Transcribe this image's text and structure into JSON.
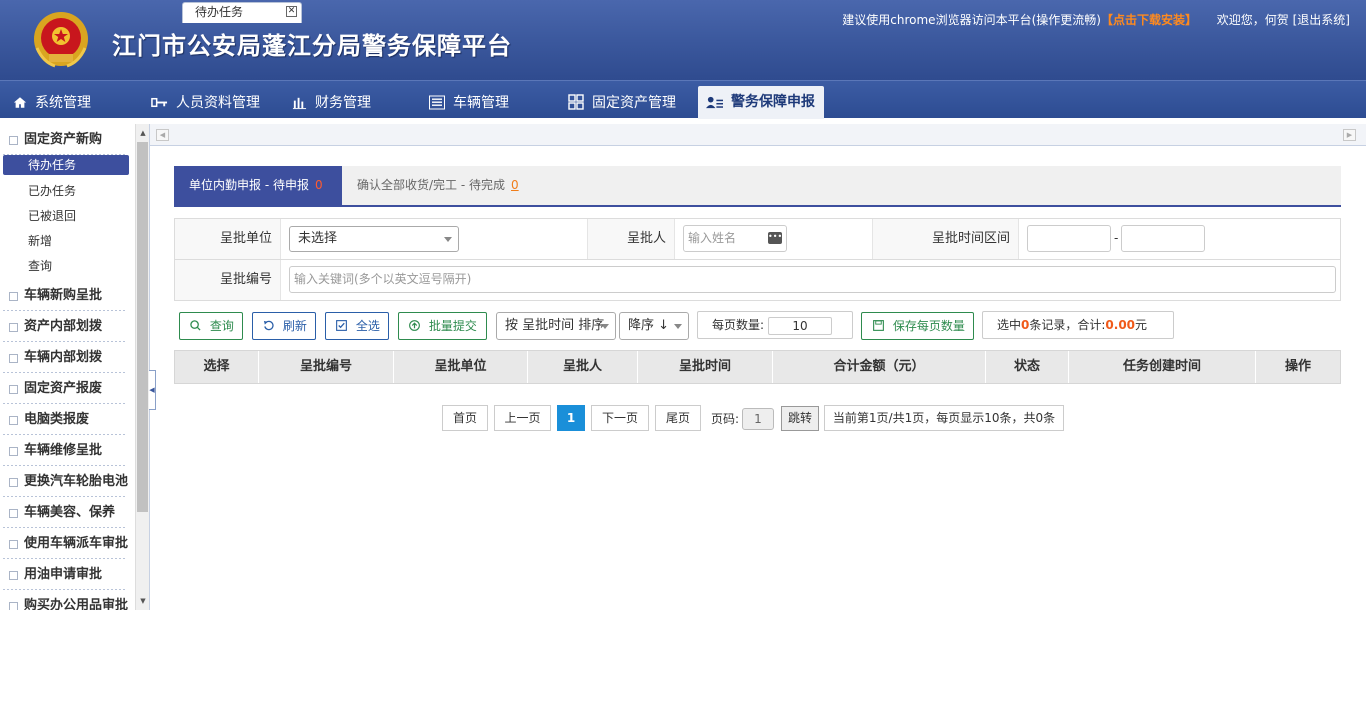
{
  "header": {
    "title": "江门市公安局蓬江分局警务保障平台",
    "browser_tip": "建议使用chrome浏览器访问本平台(操作更流畅)",
    "download_link": "【点击下载安装】",
    "welcome": "欢迎您，何贺",
    "logout": "[退出系统]"
  },
  "nav": [
    {
      "label": "系统管理",
      "icon": "home-icon"
    },
    {
      "label": "人员资料管理",
      "icon": "key-icon"
    },
    {
      "label": "财务管理",
      "icon": "bar-chart-icon"
    },
    {
      "label": "车辆管理",
      "icon": "list-icon"
    },
    {
      "label": "固定资产管理",
      "icon": "grid-icon"
    },
    {
      "label": "警务保障申报",
      "icon": "user-card-icon",
      "active": true
    }
  ],
  "sidebar": {
    "first_section": "固定资产新购",
    "first_items": [
      "待办任务",
      "已办任务",
      "已被退回",
      "新增",
      "查询"
    ],
    "sections": [
      "车辆新购呈批",
      "资产内部划拨",
      "车辆内部划拨",
      "固定资产报废",
      "电脑类报废",
      "车辆维修呈批",
      "更换汽车轮胎电池",
      "车辆美容、保养",
      "使用车辆派车审批",
      "用油申请审批",
      "购买办公用品审批"
    ]
  },
  "tabs": {
    "open_tab": "待办任务"
  },
  "subtabs": {
    "active_label": "单位内勤申报 - 待申报",
    "active_count": "0",
    "other_label": "确认全部收货/完工 - 待完成",
    "other_count": "0"
  },
  "filter": {
    "unit_label": "呈批单位",
    "unit_value": "未选择",
    "person_label": "呈批人",
    "person_placeholder": "输入姓名",
    "time_label": "呈批时间区间",
    "time_sep": "-",
    "no_label": "呈批编号",
    "no_placeholder": "输入关键词(多个以英文逗号隔开)"
  },
  "actions": {
    "query": "查询",
    "refresh": "刷新",
    "select_all": "全选",
    "batch_submit": "批量提交",
    "sort_by": "按 呈批时间 排序",
    "sort_order": "降序 ↓",
    "page_size_label": "每页数量:",
    "page_size_value": "10",
    "save_page_size": "保存每页数量",
    "sel_prefix": "选中",
    "sel_count": "0",
    "sel_mid": "条记录，合计:",
    "sel_total": "0.00",
    "sel_unit": "元"
  },
  "table": {
    "columns": [
      "选择",
      "呈批编号",
      "呈批单位",
      "呈批人",
      "呈批时间",
      "合计金额（元）",
      "状态",
      "任务创建时间",
      "操作"
    ]
  },
  "pager": {
    "first": "首页",
    "prev": "上一页",
    "current": "1",
    "next": "下一页",
    "last": "尾页",
    "page_label": "页码:",
    "page_input": "1",
    "go": "跳转",
    "summary": "当前第1页/共1页，每页显示10条，共0条"
  },
  "colors": {
    "header_blue": "#3a579c",
    "active_blue": "#3d4f9e",
    "accent_orange": "#f05a1a",
    "pager_blue": "#1a8fd9",
    "button_green": "#2e8b4e"
  }
}
